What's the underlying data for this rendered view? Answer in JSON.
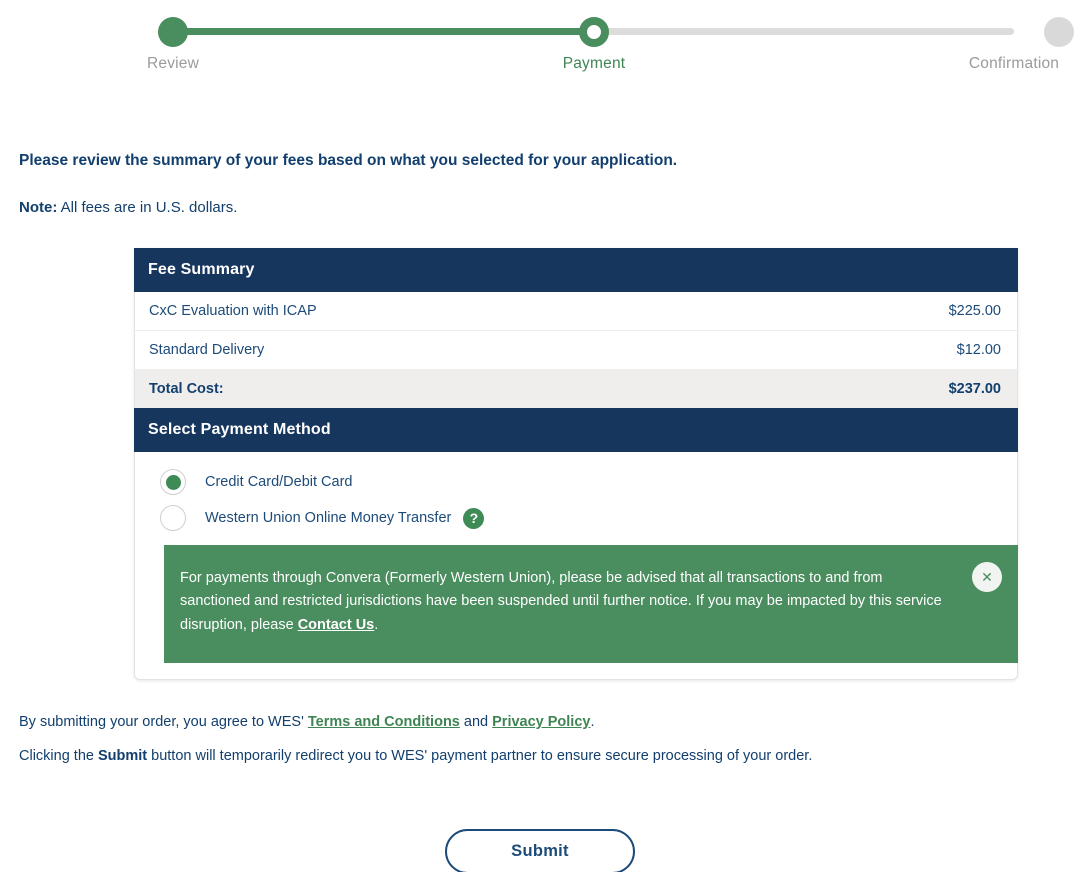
{
  "stepper": {
    "steps": [
      {
        "label": "Review",
        "state": "done"
      },
      {
        "label": "Payment",
        "state": "active"
      },
      {
        "label": "Confirmation",
        "state": "todo"
      }
    ]
  },
  "intro": {
    "title": "Please review the summary of your fees based on what you selected for your application.",
    "note_label": "Note:",
    "note_text": " All fees are in U.S. dollars."
  },
  "fee_summary": {
    "header": "Fee Summary",
    "rows": [
      {
        "label": "CxC Evaluation with ICAP",
        "amount": "$225.00"
      },
      {
        "label": "Standard Delivery",
        "amount": "$12.00"
      }
    ],
    "total": {
      "label": "Total Cost:",
      "amount": "$237.00"
    }
  },
  "payment_method": {
    "header": "Select Payment Method",
    "options": [
      {
        "label": "Credit Card/Debit Card",
        "selected": true,
        "help": false
      },
      {
        "label": "Western Union Online Money Transfer",
        "selected": false,
        "help": true
      }
    ],
    "help_icon_glyph": "?"
  },
  "alert": {
    "text_before_link": "For payments through Convera (Formerly Western Union), please be advised that all transactions to and from sanctioned and restricted jurisdictions have been suspended until further notice. If you may be impacted by this service disruption, please ",
    "link_text": "Contact Us",
    "text_after_link": ".",
    "close_glyph": "✕"
  },
  "footer": {
    "terms_prefix": "By submitting your order, you agree to WES' ",
    "terms_link": "Terms and Conditions",
    "terms_middle": " and ",
    "privacy_link": "Privacy Policy",
    "terms_suffix": ".",
    "redirect_prefix": "Clicking the ",
    "redirect_bold": "Submit",
    "redirect_suffix": " button will temporarily redirect you to WES' payment partner to ensure secure processing of your order."
  },
  "submit": {
    "label": "Submit"
  },
  "colors": {
    "navy": "#16365e",
    "navy_text": "#1d4b79",
    "green": "#4a8d5e",
    "green_text": "#3f8554",
    "total_row_bg": "#efeeec",
    "track_gray": "#dcdcdc"
  }
}
